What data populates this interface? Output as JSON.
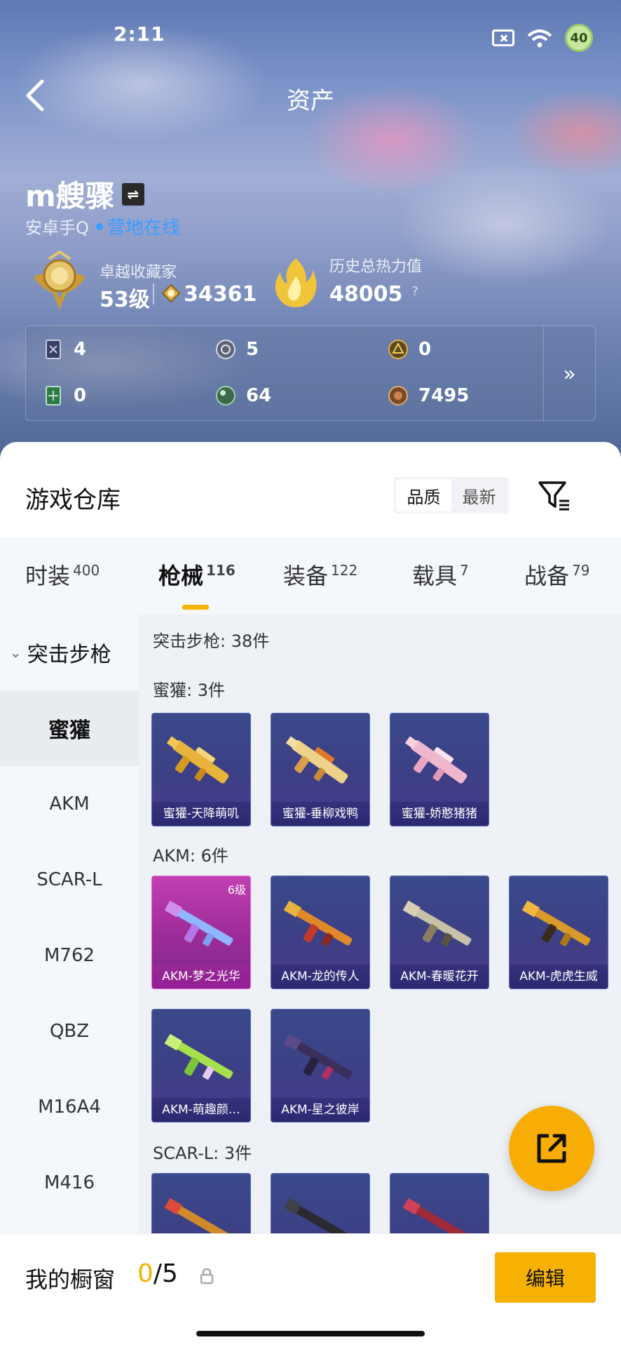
{
  "status": {
    "time": "2:11",
    "battery": "40"
  },
  "nav": {
    "title": "资产"
  },
  "profile": {
    "username": "m艘骤",
    "platform": "安卓手Q",
    "online": "营地在线",
    "rank_name": "卓越收藏家",
    "level": "53级",
    "coins": "34361",
    "heat_label": "历史总热力值",
    "heat_value": "48005",
    "help": "?"
  },
  "resources": [
    {
      "icon": "card-icon",
      "value": "4"
    },
    {
      "icon": "silver-coin-icon",
      "value": "5"
    },
    {
      "icon": "gold-token-icon",
      "value": "0"
    },
    {
      "icon": "green-card-icon",
      "value": "0"
    },
    {
      "icon": "green-orb-icon",
      "value": "64"
    },
    {
      "icon": "bronze-coin-icon",
      "value": "7495"
    }
  ],
  "warehouse": {
    "title": "游戏仓库",
    "sort_options": [
      "品质",
      "最新"
    ]
  },
  "tabs": [
    {
      "label": "时装",
      "count": "400"
    },
    {
      "label": "枪械",
      "count": "116"
    },
    {
      "label": "装备",
      "count": "122"
    },
    {
      "label": "载具",
      "count": "7"
    },
    {
      "label": "战备",
      "count": "79"
    }
  ],
  "sidebar": {
    "group": "突击步枪",
    "items": [
      "蜜獾",
      "AKM",
      "SCAR-L",
      "M762",
      "QBZ",
      "M16A4",
      "M416"
    ]
  },
  "content": {
    "section_title": "突击步枪: 38件",
    "groups": [
      {
        "title": "蜜獾: 3件",
        "items": [
          "蜜獾-天降萌叽",
          "蜜獾-垂柳戏鸭",
          "蜜獾-娇憨猪猪"
        ]
      },
      {
        "title": "AKM: 6件",
        "items": [
          "AKM-梦之光华",
          "AKM-龙的传人",
          "AKM-春暖花开",
          "AKM-虎虎生威",
          "AKM-萌趣颜…",
          "AKM-星之彼岸"
        ],
        "first_level": "6级"
      },
      {
        "title": "SCAR-L: 3件",
        "items": [
          "",
          "",
          ""
        ]
      }
    ]
  },
  "bottom": {
    "title": "我的橱窗",
    "count_current": "0",
    "count_total": "/5",
    "edit": "编辑"
  },
  "colors": {
    "accent": "#f7b102",
    "online": "#3b9cff"
  }
}
